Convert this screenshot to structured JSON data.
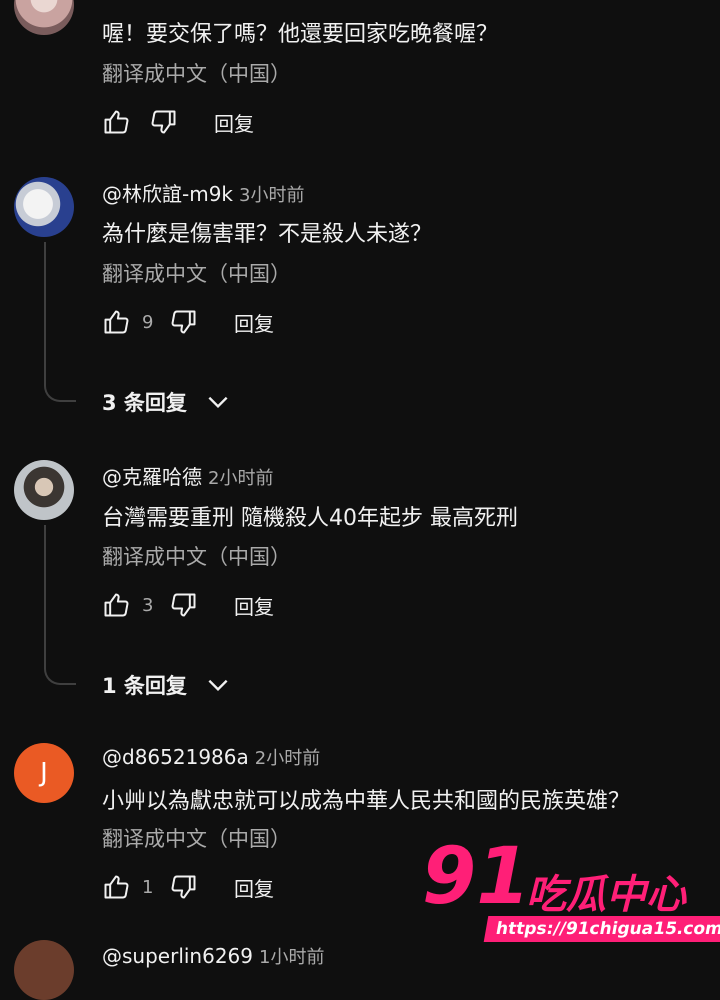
{
  "comments": [
    {
      "text": "喔！要交保了嗎？他還要回家吃晚餐喔？",
      "translate": "翻译成中文（中国）",
      "likes": "",
      "reply": "回复"
    },
    {
      "author": "@林欣誼-m9k",
      "time": "3小时前",
      "text": "為什麼是傷害罪？不是殺人未遂？",
      "translate": "翻译成中文（中国）",
      "likes": "9",
      "reply": "回复",
      "replies": "3 条回复"
    },
    {
      "author": "@克羅哈德",
      "time": "2小时前",
      "text": "台灣需要重刑 隨機殺人40年起步 最高死刑",
      "translate": "翻译成中文（中国）",
      "likes": "3",
      "reply": "回复",
      "replies": "1 条回复"
    },
    {
      "author": "@d86521986a",
      "time": "2小时前",
      "avatar_letter": "J",
      "text": "小艸以為獻忠就可以成為中華人民共和國的民族英雄？",
      "translate": "翻译成中文（中国）",
      "likes": "1",
      "reply": "回复"
    },
    {
      "author": "@superlin6269",
      "time": "1小时前"
    }
  ],
  "watermark": {
    "number": "91",
    "name": "吃瓜中心",
    "url": "https://91chigua15.com"
  },
  "colors": {
    "background": "#0f0f0f",
    "secondary_text": "#aaaaaa",
    "watermark": "#ff1f77",
    "avatar_j": "#ea5a24"
  }
}
